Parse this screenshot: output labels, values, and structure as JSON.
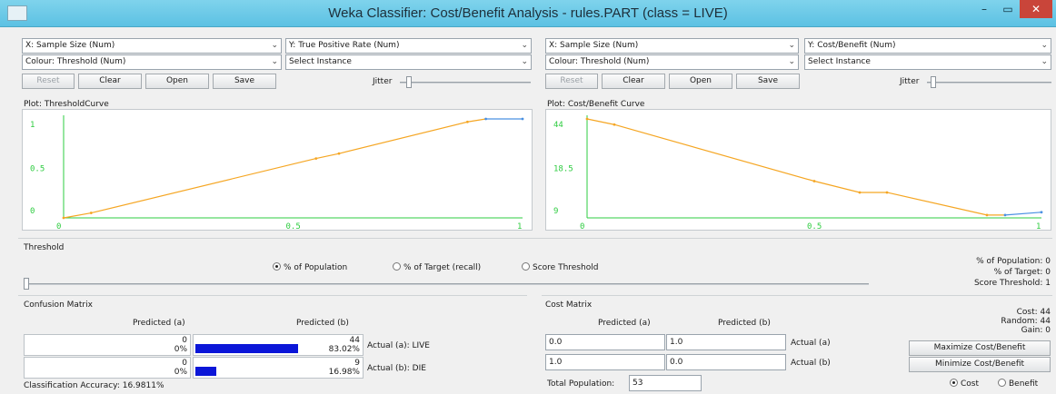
{
  "window": {
    "title": "Weka Classifier: Cost/Benefit Analysis - rules.PART (class = LIVE)",
    "min_glyph": "–",
    "max_glyph": "▭",
    "close_glyph": "✕"
  },
  "left_plot": {
    "x_combo": "X: Sample Size (Num)",
    "y_combo": "Y: True Positive Rate (Num)",
    "colour_combo": "Colour: Threshold (Num)",
    "instance_combo": "Select Instance",
    "reset": "Reset",
    "clear": "Clear",
    "open": "Open",
    "save": "Save",
    "jitter": "Jitter",
    "plot_title": "Plot: ThresholdCurve",
    "y_ticks": [
      "1",
      "0.5",
      "0"
    ],
    "x_ticks": [
      "0",
      "0.5",
      "1"
    ]
  },
  "right_plot": {
    "x_combo": "X: Sample Size (Num)",
    "y_combo": "Y: Cost/Benefit (Num)",
    "colour_combo": "Colour: Threshold (Num)",
    "instance_combo": "Select Instance",
    "reset": "Reset",
    "clear": "Clear",
    "open": "Open",
    "save": "Save",
    "jitter": "Jitter",
    "plot_title": "Plot: Cost/Benefit Curve",
    "y_ticks": [
      "44",
      "18.5",
      "9"
    ],
    "x_ticks": [
      "0",
      "0.5",
      "1"
    ]
  },
  "threshold": {
    "label": "Threshold",
    "radio_population": "% of Population",
    "radio_target": "% of Target (recall)",
    "radio_score": "Score Threshold",
    "pop_readout": "% of Population: 0",
    "target_readout": "% of Target: 0",
    "score_readout": "Score Threshold: 1",
    "slider_level": 0
  },
  "confusion": {
    "label": "Confusion Matrix",
    "pred_a": "Predicted (a)",
    "pred_b": "Predicted (b)",
    "row1": {
      "a_count": "0",
      "a_pct": "0%",
      "b_count": "44",
      "b_pct": "83.02%",
      "actual": "Actual (a): LIVE",
      "bar_fraction": 0.8302
    },
    "row2": {
      "a_count": "0",
      "a_pct": "0%",
      "b_count": "9",
      "b_pct": "16.98%",
      "actual": "Actual (b): DIE",
      "bar_fraction": 0.1698
    },
    "accuracy": "Classification Accuracy:  16.9811%"
  },
  "cost": {
    "label": "Cost Matrix",
    "pred_a": "Predicted (a)",
    "pred_b": "Predicted (b)",
    "r1c1": "0.0",
    "r1c2": "1.0",
    "actual_a": "Actual (a)",
    "r2c1": "1.0",
    "r2c2": "0.0",
    "actual_b": "Actual (b)",
    "total_label": "Total Population:",
    "total_value": "53",
    "cost_readout": "Cost: 44",
    "random_readout": "Random: 44",
    "gain_readout": "Gain: 0",
    "maximize": "Maximize Cost/Benefit",
    "minimize": "Minimize Cost/Benefit",
    "radio_cost": "Cost",
    "radio_benefit": "Benefit"
  },
  "chart_data": [
    {
      "type": "line",
      "title": "Plot: ThresholdCurve",
      "xlabel": "Sample Size",
      "ylabel": "True Positive Rate",
      "xlim": [
        0,
        1
      ],
      "ylim": [
        0,
        1
      ],
      "series": [
        {
          "x": [
            0,
            0.06,
            0.55,
            0.6,
            0.88,
            0.92,
            1
          ],
          "y": [
            0,
            0.05,
            0.6,
            0.65,
            0.97,
            1,
            1
          ]
        }
      ],
      "colors": [
        "#f5a623",
        "#4a90e2"
      ]
    },
    {
      "type": "line",
      "title": "Plot: Cost/Benefit Curve",
      "xlabel": "Sample Size",
      "ylabel": "Cost/Benefit",
      "xlim": [
        0,
        1
      ],
      "ylim": [
        9,
        44
      ],
      "series": [
        {
          "x": [
            0,
            0.06,
            0.5,
            0.6,
            0.66,
            0.88,
            0.92,
            1
          ],
          "y": [
            44,
            42,
            22,
            18,
            18,
            10,
            10,
            11
          ]
        }
      ],
      "colors": [
        "#f5a623",
        "#4a90e2"
      ]
    }
  ]
}
